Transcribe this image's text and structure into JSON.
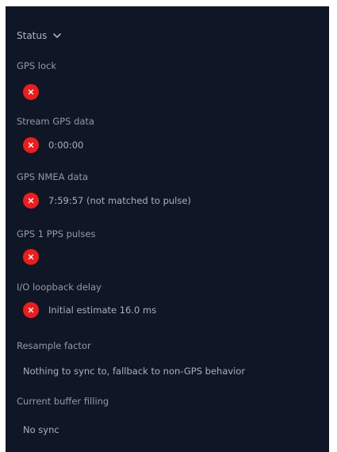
{
  "header": {
    "title": "Status",
    "icon": "chevron-down-icon"
  },
  "colors": {
    "panel_bg": "#0f1726",
    "error": "#ef1c1c",
    "label": "#8f9aab",
    "value": "#a7b1bf"
  },
  "items": [
    {
      "label": "GPS lock",
      "status": "error",
      "icon": "error-x-icon",
      "value": ""
    },
    {
      "label": "Stream GPS data",
      "status": "error",
      "icon": "error-x-icon",
      "value": "0:00:00"
    },
    {
      "label": "GPS NMEA data",
      "status": "error",
      "icon": "error-x-icon",
      "value": "7:59:57 (not matched to pulse)"
    },
    {
      "label": "GPS 1 PPS pulses",
      "status": "error",
      "icon": "error-x-icon",
      "value": ""
    },
    {
      "label": "I/O loopback delay",
      "status": "error",
      "icon": "error-x-icon",
      "value": "Initial estimate 16.0 ms"
    },
    {
      "label": "Resample factor",
      "value": "Nothing to sync to, fallback to non-GPS behavior"
    },
    {
      "label": "Current buffer filling",
      "value": "No sync"
    }
  ]
}
